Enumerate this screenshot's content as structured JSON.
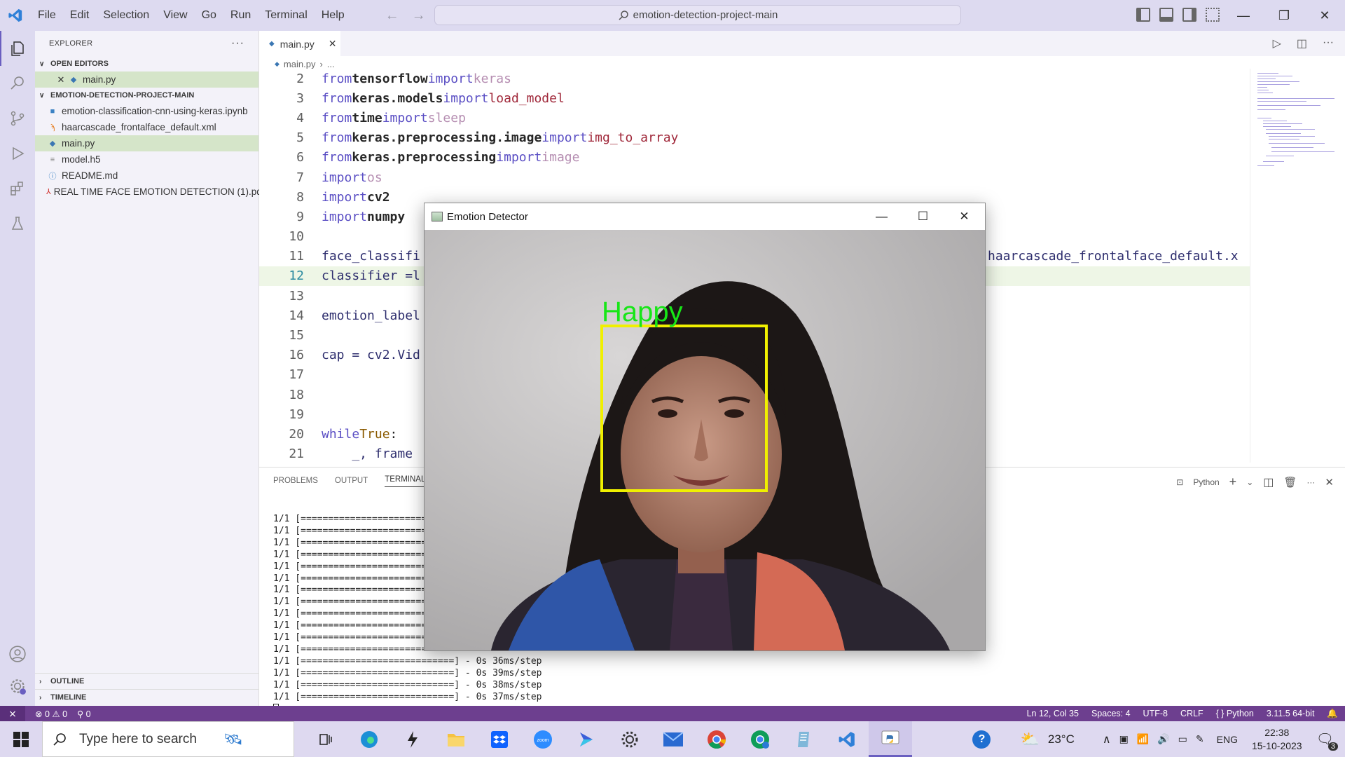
{
  "titlebar": {
    "menu": [
      "File",
      "Edit",
      "Selection",
      "View",
      "Go",
      "Run",
      "Terminal",
      "Help"
    ],
    "search_text": "emotion-detection-project-main"
  },
  "sidebar": {
    "title": "EXPLORER",
    "open_editors_label": "OPEN EDITORS",
    "open_editors": [
      {
        "name": "main.py"
      }
    ],
    "project_label": "EMOTION-DETECTION-PROJECT-MAIN",
    "files": [
      {
        "name": "emotion-classification-cnn-using-keras.ipynb",
        "icon": "notebook-icon",
        "color": "#3b82c4"
      },
      {
        "name": "haarcascade_frontalface_default.xml",
        "icon": "rss-icon",
        "color": "#e67e22"
      },
      {
        "name": "main.py",
        "icon": "python-icon",
        "color": "#3b77b3"
      },
      {
        "name": "model.h5",
        "icon": "file-icon",
        "color": "#888888"
      },
      {
        "name": "README.md",
        "icon": "info-icon",
        "color": "#3b82c4"
      },
      {
        "name": "REAL TIME FACE EMOTION DETECTION (1).pdf",
        "icon": "pdf-icon",
        "color": "#d0312d"
      }
    ],
    "outline_label": "OUTLINE",
    "timeline_label": "TIMELINE"
  },
  "editor": {
    "tab_label": "main.py",
    "breadcrumb_file": "main.py",
    "breadcrumb_more": "...",
    "line_numbers": [
      "2",
      "3",
      "4",
      "5",
      "6",
      "7",
      "8",
      "9",
      "10",
      "11",
      "12",
      "13",
      "14",
      "15",
      "16",
      "17",
      "18",
      "19",
      "20",
      "21"
    ],
    "lines": [
      {
        "from": "from",
        "module": "tensorflow",
        "imp": "import",
        "name": "keras",
        "name_style": "dim"
      },
      {
        "from": "from",
        "module": "keras.models",
        "imp": "import",
        "name": "load_model",
        "name_style": "fn"
      },
      {
        "from": "from",
        "module": "time",
        "imp": "import",
        "name": "sleep",
        "name_style": "dim"
      },
      {
        "from": "from",
        "module": "keras.preprocessing.image",
        "imp": "import",
        "name": "img_to_array",
        "name_style": "fn"
      },
      {
        "from": "from",
        "module": "keras.preprocessing",
        "imp": "import",
        "name": "image",
        "name_style": "dim"
      }
    ],
    "import_os": {
      "kw": "import",
      "name": "os"
    },
    "import_cv2": {
      "kw": "import",
      "name": "cv2"
    },
    "import_numpy": {
      "kw": "import",
      "name": "numpy"
    },
    "line11_text": "face_classifi",
    "line11_right": "haarcascade_frontalface_default.x",
    "line12_text": "classifier =l",
    "line14_text": "emotion_label",
    "line16_text": "cap = cv2.Vid",
    "line20_kw": "while",
    "line20_val": "True",
    "line20_colon": ":",
    "line21_text": "    _, frame"
  },
  "panel": {
    "tabs": [
      "PROBLEMS",
      "OUTPUT",
      "TERMINAL"
    ],
    "shell": "Python",
    "terminal_lines": [
      "1/1 [===========================",
      "1/1 [===========================",
      "1/1 [===========================",
      "1/1 [===========================",
      "1/1 [===========================",
      "1/1 [===========================",
      "1/1 [===========================",
      "1/1 [===========================",
      "1/1 [===========================",
      "1/1 [===========================",
      "1/1 [===========================",
      "1/1 [===========================",
      "1/1 [============================] - 0s 36ms/step",
      "1/1 [============================] - 0s 39ms/step",
      "1/1 [============================] - 0s 38ms/step",
      "1/1 [============================] - 0s 37ms/step"
    ]
  },
  "dialog": {
    "title": "Emotion Detector",
    "label": "Happy",
    "label_color": "#17e617",
    "box_color": "#f0f000"
  },
  "statusbar": {
    "errors": "0",
    "warnings": "0",
    "ports": "0",
    "position": "Ln 12, Col 35",
    "spaces": "Spaces: 4",
    "encoding": "UTF-8",
    "eol": "CRLF",
    "language": "Python",
    "interpreter": "3.11.5 64-bit"
  },
  "taskbar": {
    "search_placeholder": "Type here to search",
    "temperature": "23°C",
    "language": "ENG",
    "time": "22:38",
    "date": "15-10-2023",
    "notification_count": "3"
  },
  "colors": {
    "accent": "#6d3f8f",
    "titlebar": "#dddaf0",
    "selection": "#d5e5c9"
  }
}
